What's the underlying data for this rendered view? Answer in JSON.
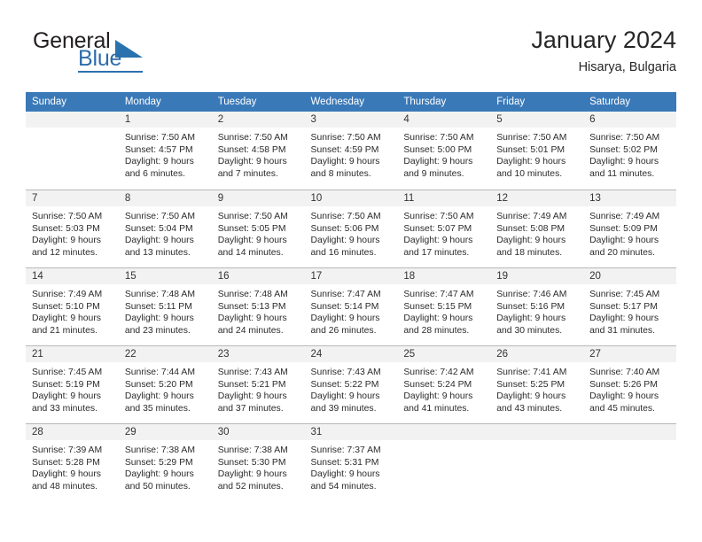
{
  "brand": {
    "word_one": "General",
    "word_two": "Blue",
    "accent_color": "#2a72ad"
  },
  "header": {
    "title": "January 2024",
    "subtitle": "Hisarya, Bulgaria",
    "header_bg_color": "#3a79b8",
    "daynum_band_color": "#f2f2f2"
  },
  "weekdays": [
    "Sunday",
    "Monday",
    "Tuesday",
    "Wednesday",
    "Thursday",
    "Friday",
    "Saturday"
  ],
  "weeks": [
    [
      {
        "day": "",
        "sunrise": "",
        "sunset": "",
        "daylight_line1": "",
        "daylight_line2": ""
      },
      {
        "day": "1",
        "sunrise": "Sunrise: 7:50 AM",
        "sunset": "Sunset: 4:57 PM",
        "daylight_line1": "Daylight: 9 hours",
        "daylight_line2": "and 6 minutes."
      },
      {
        "day": "2",
        "sunrise": "Sunrise: 7:50 AM",
        "sunset": "Sunset: 4:58 PM",
        "daylight_line1": "Daylight: 9 hours",
        "daylight_line2": "and 7 minutes."
      },
      {
        "day": "3",
        "sunrise": "Sunrise: 7:50 AM",
        "sunset": "Sunset: 4:59 PM",
        "daylight_line1": "Daylight: 9 hours",
        "daylight_line2": "and 8 minutes."
      },
      {
        "day": "4",
        "sunrise": "Sunrise: 7:50 AM",
        "sunset": "Sunset: 5:00 PM",
        "daylight_line1": "Daylight: 9 hours",
        "daylight_line2": "and 9 minutes."
      },
      {
        "day": "5",
        "sunrise": "Sunrise: 7:50 AM",
        "sunset": "Sunset: 5:01 PM",
        "daylight_line1": "Daylight: 9 hours",
        "daylight_line2": "and 10 minutes."
      },
      {
        "day": "6",
        "sunrise": "Sunrise: 7:50 AM",
        "sunset": "Sunset: 5:02 PM",
        "daylight_line1": "Daylight: 9 hours",
        "daylight_line2": "and 11 minutes."
      }
    ],
    [
      {
        "day": "7",
        "sunrise": "Sunrise: 7:50 AM",
        "sunset": "Sunset: 5:03 PM",
        "daylight_line1": "Daylight: 9 hours",
        "daylight_line2": "and 12 minutes."
      },
      {
        "day": "8",
        "sunrise": "Sunrise: 7:50 AM",
        "sunset": "Sunset: 5:04 PM",
        "daylight_line1": "Daylight: 9 hours",
        "daylight_line2": "and 13 minutes."
      },
      {
        "day": "9",
        "sunrise": "Sunrise: 7:50 AM",
        "sunset": "Sunset: 5:05 PM",
        "daylight_line1": "Daylight: 9 hours",
        "daylight_line2": "and 14 minutes."
      },
      {
        "day": "10",
        "sunrise": "Sunrise: 7:50 AM",
        "sunset": "Sunset: 5:06 PM",
        "daylight_line1": "Daylight: 9 hours",
        "daylight_line2": "and 16 minutes."
      },
      {
        "day": "11",
        "sunrise": "Sunrise: 7:50 AM",
        "sunset": "Sunset: 5:07 PM",
        "daylight_line1": "Daylight: 9 hours",
        "daylight_line2": "and 17 minutes."
      },
      {
        "day": "12",
        "sunrise": "Sunrise: 7:49 AM",
        "sunset": "Sunset: 5:08 PM",
        "daylight_line1": "Daylight: 9 hours",
        "daylight_line2": "and 18 minutes."
      },
      {
        "day": "13",
        "sunrise": "Sunrise: 7:49 AM",
        "sunset": "Sunset: 5:09 PM",
        "daylight_line1": "Daylight: 9 hours",
        "daylight_line2": "and 20 minutes."
      }
    ],
    [
      {
        "day": "14",
        "sunrise": "Sunrise: 7:49 AM",
        "sunset": "Sunset: 5:10 PM",
        "daylight_line1": "Daylight: 9 hours",
        "daylight_line2": "and 21 minutes."
      },
      {
        "day": "15",
        "sunrise": "Sunrise: 7:48 AM",
        "sunset": "Sunset: 5:11 PM",
        "daylight_line1": "Daylight: 9 hours",
        "daylight_line2": "and 23 minutes."
      },
      {
        "day": "16",
        "sunrise": "Sunrise: 7:48 AM",
        "sunset": "Sunset: 5:13 PM",
        "daylight_line1": "Daylight: 9 hours",
        "daylight_line2": "and 24 minutes."
      },
      {
        "day": "17",
        "sunrise": "Sunrise: 7:47 AM",
        "sunset": "Sunset: 5:14 PM",
        "daylight_line1": "Daylight: 9 hours",
        "daylight_line2": "and 26 minutes."
      },
      {
        "day": "18",
        "sunrise": "Sunrise: 7:47 AM",
        "sunset": "Sunset: 5:15 PM",
        "daylight_line1": "Daylight: 9 hours",
        "daylight_line2": "and 28 minutes."
      },
      {
        "day": "19",
        "sunrise": "Sunrise: 7:46 AM",
        "sunset": "Sunset: 5:16 PM",
        "daylight_line1": "Daylight: 9 hours",
        "daylight_line2": "and 30 minutes."
      },
      {
        "day": "20",
        "sunrise": "Sunrise: 7:45 AM",
        "sunset": "Sunset: 5:17 PM",
        "daylight_line1": "Daylight: 9 hours",
        "daylight_line2": "and 31 minutes."
      }
    ],
    [
      {
        "day": "21",
        "sunrise": "Sunrise: 7:45 AM",
        "sunset": "Sunset: 5:19 PM",
        "daylight_line1": "Daylight: 9 hours",
        "daylight_line2": "and 33 minutes."
      },
      {
        "day": "22",
        "sunrise": "Sunrise: 7:44 AM",
        "sunset": "Sunset: 5:20 PM",
        "daylight_line1": "Daylight: 9 hours",
        "daylight_line2": "and 35 minutes."
      },
      {
        "day": "23",
        "sunrise": "Sunrise: 7:43 AM",
        "sunset": "Sunset: 5:21 PM",
        "daylight_line1": "Daylight: 9 hours",
        "daylight_line2": "and 37 minutes."
      },
      {
        "day": "24",
        "sunrise": "Sunrise: 7:43 AM",
        "sunset": "Sunset: 5:22 PM",
        "daylight_line1": "Daylight: 9 hours",
        "daylight_line2": "and 39 minutes."
      },
      {
        "day": "25",
        "sunrise": "Sunrise: 7:42 AM",
        "sunset": "Sunset: 5:24 PM",
        "daylight_line1": "Daylight: 9 hours",
        "daylight_line2": "and 41 minutes."
      },
      {
        "day": "26",
        "sunrise": "Sunrise: 7:41 AM",
        "sunset": "Sunset: 5:25 PM",
        "daylight_line1": "Daylight: 9 hours",
        "daylight_line2": "and 43 minutes."
      },
      {
        "day": "27",
        "sunrise": "Sunrise: 7:40 AM",
        "sunset": "Sunset: 5:26 PM",
        "daylight_line1": "Daylight: 9 hours",
        "daylight_line2": "and 45 minutes."
      }
    ],
    [
      {
        "day": "28",
        "sunrise": "Sunrise: 7:39 AM",
        "sunset": "Sunset: 5:28 PM",
        "daylight_line1": "Daylight: 9 hours",
        "daylight_line2": "and 48 minutes."
      },
      {
        "day": "29",
        "sunrise": "Sunrise: 7:38 AM",
        "sunset": "Sunset: 5:29 PM",
        "daylight_line1": "Daylight: 9 hours",
        "daylight_line2": "and 50 minutes."
      },
      {
        "day": "30",
        "sunrise": "Sunrise: 7:38 AM",
        "sunset": "Sunset: 5:30 PM",
        "daylight_line1": "Daylight: 9 hours",
        "daylight_line2": "and 52 minutes."
      },
      {
        "day": "31",
        "sunrise": "Sunrise: 7:37 AM",
        "sunset": "Sunset: 5:31 PM",
        "daylight_line1": "Daylight: 9 hours",
        "daylight_line2": "and 54 minutes."
      },
      {
        "day": "",
        "sunrise": "",
        "sunset": "",
        "daylight_line1": "",
        "daylight_line2": ""
      },
      {
        "day": "",
        "sunrise": "",
        "sunset": "",
        "daylight_line1": "",
        "daylight_line2": ""
      },
      {
        "day": "",
        "sunrise": "",
        "sunset": "",
        "daylight_line1": "",
        "daylight_line2": ""
      }
    ]
  ]
}
